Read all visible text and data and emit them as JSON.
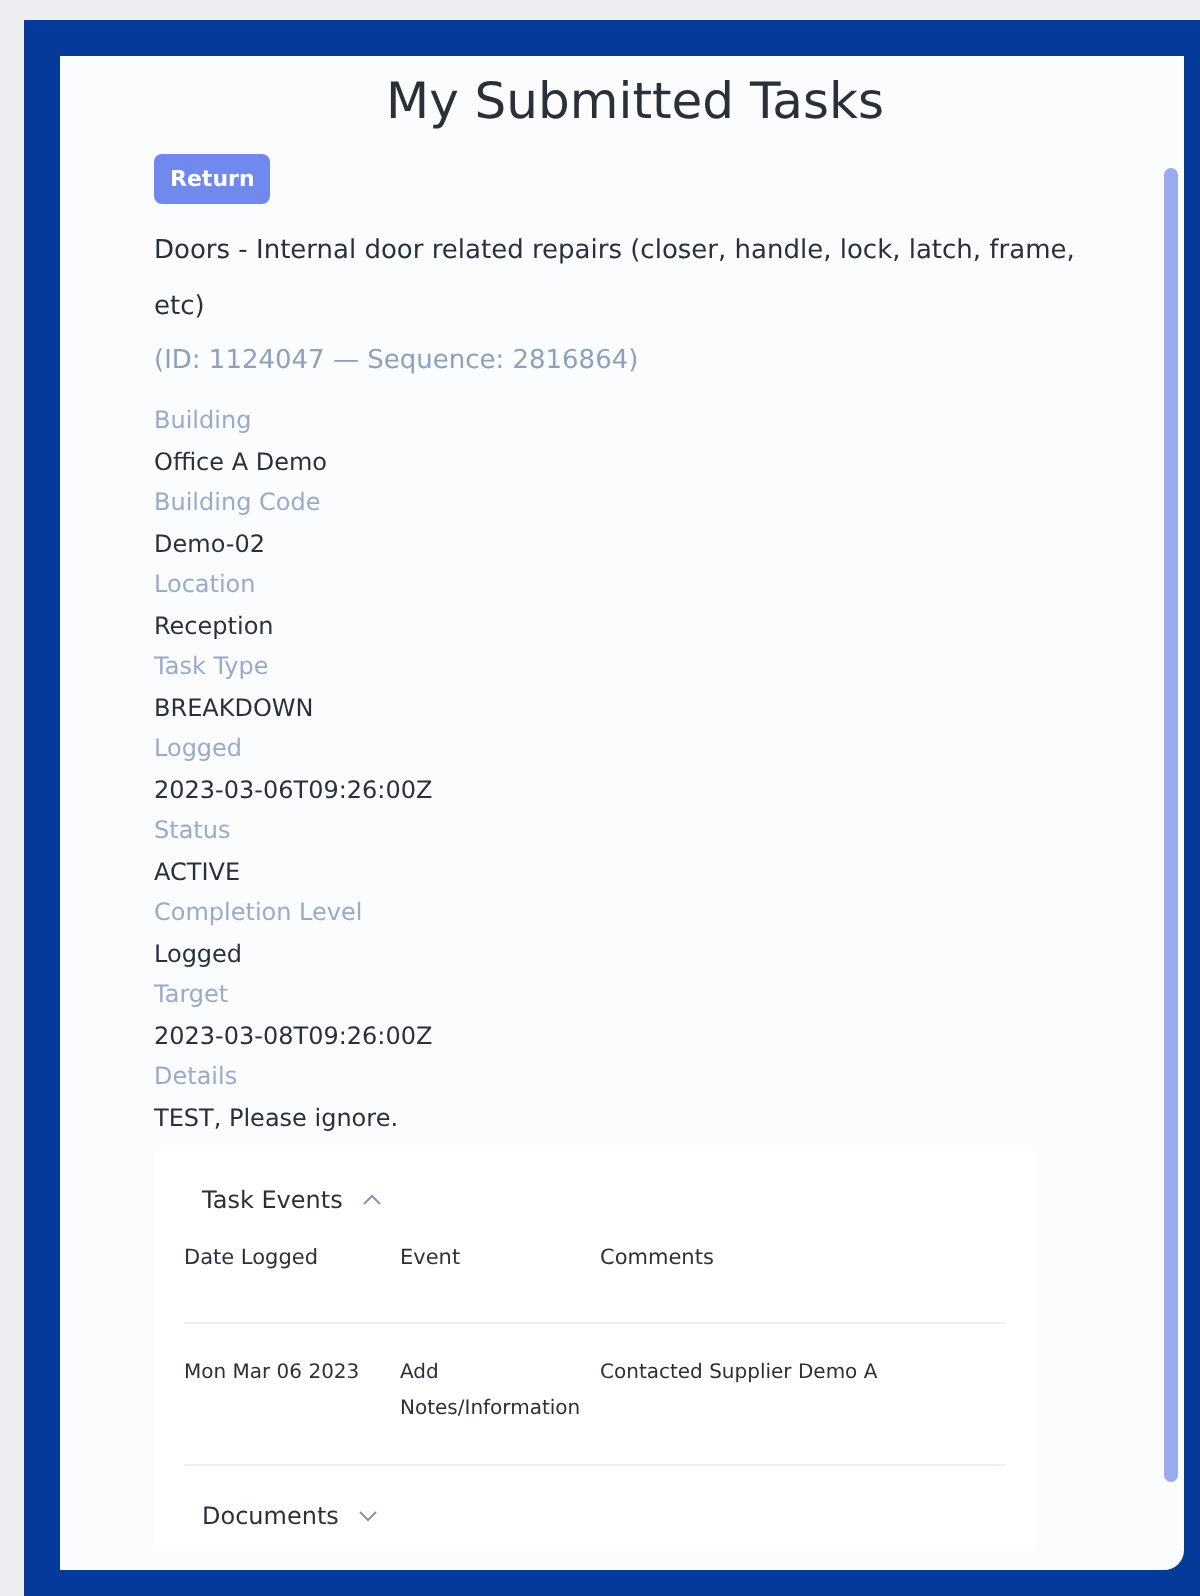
{
  "page": {
    "title": "My Submitted Tasks"
  },
  "return_button": "Return",
  "task": {
    "description": "Doors - Internal door related repairs (closer, handle, lock, latch, frame, etc)",
    "id_line": "(ID: 1124047 — Sequence: 2816864)"
  },
  "fields": [
    {
      "label": "Building",
      "value": "Office A Demo"
    },
    {
      "label": "Building Code",
      "value": "Demo-02"
    },
    {
      "label": "Location",
      "value": "Reception"
    },
    {
      "label": "Task Type",
      "value": "BREAKDOWN"
    },
    {
      "label": "Logged",
      "value": "2023-03-06T09:26:00Z"
    },
    {
      "label": "Status",
      "value": "ACTIVE"
    },
    {
      "label": "Completion Level",
      "value": "Logged"
    },
    {
      "label": "Target",
      "value": "2023-03-08T09:26:00Z"
    },
    {
      "label": "Details",
      "value": "TEST, Please ignore."
    }
  ],
  "sections": [
    {
      "title": "Task Events",
      "expanded": true,
      "table": {
        "columns": [
          "Date Logged",
          "Event",
          "Comments"
        ],
        "rows": [
          [
            "Mon Mar 06 2023",
            "Add Notes/Information",
            "Contacted Supplier Demo A"
          ]
        ]
      }
    },
    {
      "title": "Documents",
      "expanded": false
    }
  ]
}
